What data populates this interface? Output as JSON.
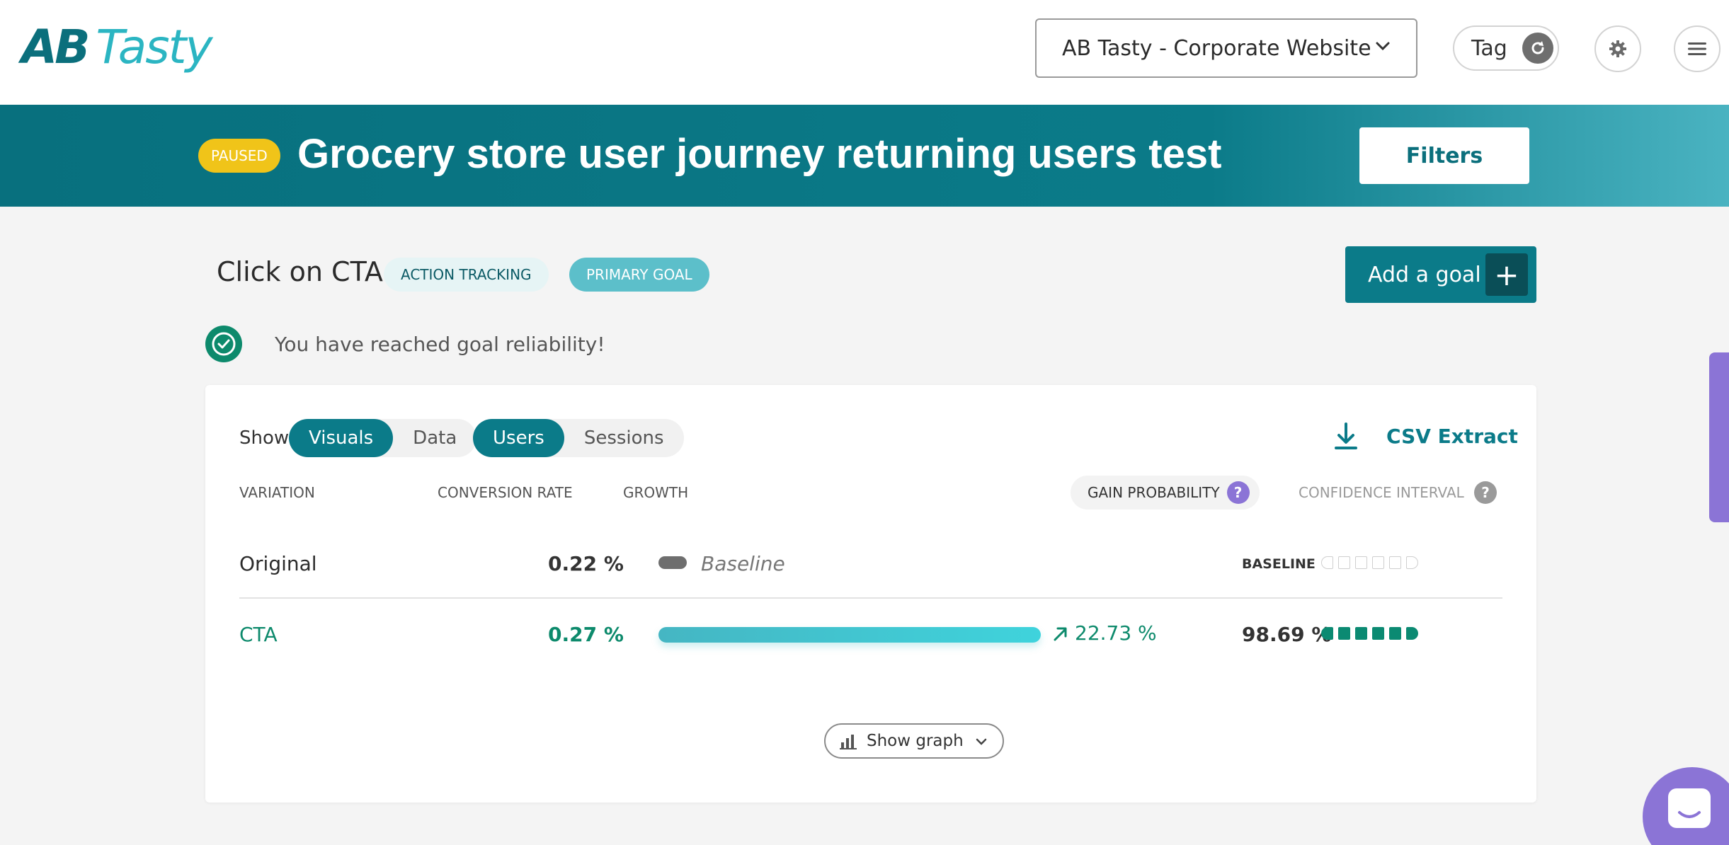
{
  "header": {
    "logo_ab": "AB",
    "logo_tasty": "Tasty",
    "site_select": "AB Tasty - Corporate Website",
    "tag_label": "Tag",
    "icons": {
      "refresh": "refresh-icon",
      "settings": "gear-icon",
      "menu": "hamburger-icon",
      "dropdown": "chevron-down-icon"
    }
  },
  "banner": {
    "status": "PAUSED",
    "title": "Grocery store user journey returning users test",
    "filters_label": "Filters"
  },
  "goal": {
    "name": "Click on CTA",
    "tags": [
      "ACTION TRACKING",
      "PRIMARY GOAL"
    ],
    "add_goal_label": "Add a goal",
    "add_goal_icon": "+",
    "reliability_text": "You have reached goal reliability!"
  },
  "report": {
    "show_label": "Show:",
    "view_options": [
      "Visuals",
      "Data"
    ],
    "active_view": "Visuals",
    "metric_options": [
      "Users",
      "Sessions"
    ],
    "active_metric": "Users",
    "csv_label": "CSV Extract",
    "columns": {
      "variation": "VARIATION",
      "conversion_rate": "CONVERSION RATE",
      "growth": "GROWTH",
      "gain_probability": "GAIN PROBABILITY",
      "confidence_interval": "CONFIDENCE INTERVAL",
      "help_glyph": "?"
    },
    "rows": [
      {
        "variation": "Original",
        "conversion_rate": "0.22 %",
        "growth": "Baseline",
        "gain_probability": "BASELINE",
        "reliability_filled": 0
      },
      {
        "variation": "CTA",
        "conversion_rate": "0.27 %",
        "growth": "22.73 %",
        "gain_probability": "98.69 %",
        "reliability_filled": 6
      }
    ],
    "show_graph_label": "Show graph"
  },
  "colors": {
    "brand_dark": "#0b7b89",
    "brand_light": "#5cbfca",
    "paused_badge": "#f0c419",
    "success": "#0d8a6c",
    "help_purple": "#8b74d6"
  }
}
